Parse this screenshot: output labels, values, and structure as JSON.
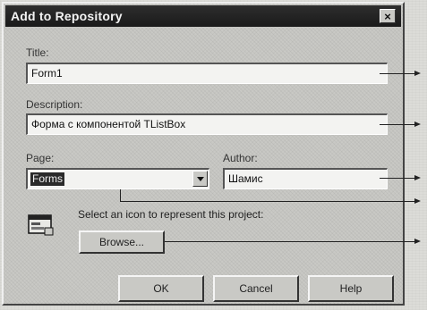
{
  "dialog": {
    "title": "Add to Repository",
    "close_glyph": "×",
    "close_icon": "close-icon"
  },
  "form": {
    "title_label": "Title:",
    "title_value": "Form1",
    "description_label": "Description:",
    "description_value": "Форма с компонентой TListBox",
    "page_label": "Page:",
    "page_value": "Forms",
    "author_label": "Author:",
    "author_value": "Шамис",
    "icon_prompt": "Select an icon to represent this project:",
    "project_icon": "form-window-icon"
  },
  "buttons": {
    "browse": "Browse...",
    "ok": "OK",
    "cancel": "Cancel",
    "help": "Help"
  }
}
